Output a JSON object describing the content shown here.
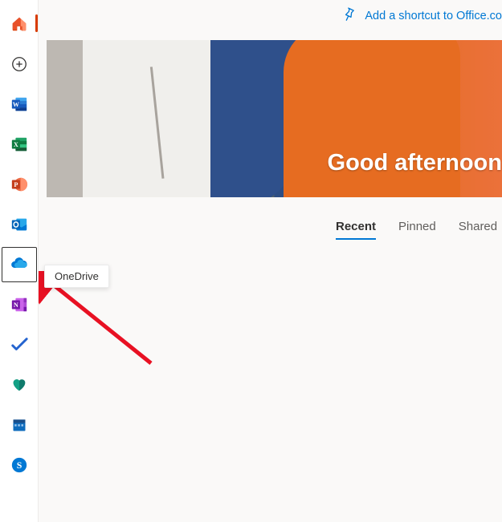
{
  "shortcut": {
    "label": "Add a shortcut to Office.co"
  },
  "banner": {
    "greeting": "Good afternoon"
  },
  "tabs": {
    "recent": "Recent",
    "pinned": "Pinned",
    "shared": "Shared"
  },
  "sidebar": {
    "home": "Home",
    "create": "Create",
    "word": "Word",
    "excel": "Excel",
    "powerpoint": "PowerPoint",
    "outlook": "Outlook",
    "onedrive": "OneDrive",
    "onenote": "OneNote",
    "todo": "To Do",
    "family": "Family Safety",
    "calendar": "Calendar",
    "skype": "Skype"
  },
  "tooltip": {
    "label": "OneDrive"
  }
}
